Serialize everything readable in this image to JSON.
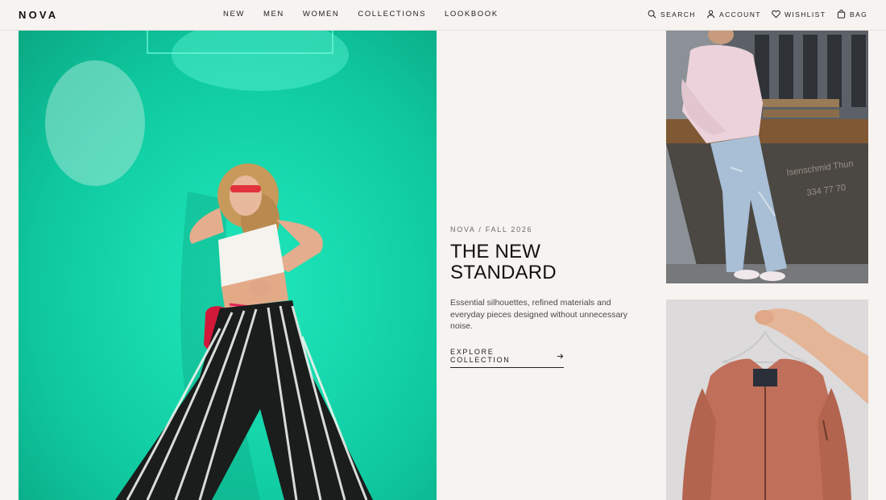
{
  "brand": {
    "name": "NOVA"
  },
  "nav": {
    "items": [
      {
        "label": "NEW"
      },
      {
        "label": "MEN"
      },
      {
        "label": "WOMEN"
      },
      {
        "label": "COLLECTIONS"
      },
      {
        "label": "LOOKBOOK"
      }
    ]
  },
  "utilities": {
    "search": {
      "label": "SEARCH",
      "icon": "search-icon"
    },
    "account": {
      "label": "ACCOUNT",
      "icon": "user-icon"
    },
    "wishlist": {
      "label": "WISHLIST",
      "icon": "heart-icon"
    },
    "bag": {
      "label": "BAG",
      "icon": "bag-icon"
    }
  },
  "hero": {
    "eyebrow": "NOVA / FALL 2026",
    "headline": "THE NEW STANDARD",
    "body": "Essential silhouettes, refined materials and everyday pieces designed without unnecessary noise.",
    "cta": {
      "label": "EXPLORE COLLECTION",
      "icon": "arrow-right-icon"
    }
  },
  "colors": {
    "background": "#f6f3f0",
    "text": "#111111",
    "hero_wall": "#17d8ad",
    "accent_jacket": "#c06f5a"
  }
}
